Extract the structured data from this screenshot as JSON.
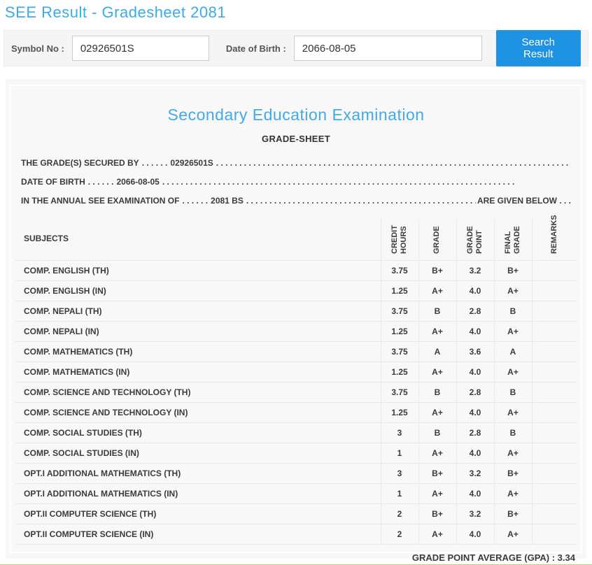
{
  "page": {
    "title": "SEE Result - Gradesheet 2081"
  },
  "search": {
    "symbol_label": "Symbol No :",
    "symbol_value": "02926501S",
    "dob_label": "Date of Birth :",
    "dob_value": "2066-08-05",
    "button_label": "Search Result"
  },
  "sheet": {
    "heading": "Secondary Education Examination",
    "subheading": "GRADE-SHEET",
    "dots_short": ". . . . . .",
    "dots_long": ". . . . . . . . . . . . . . . . . . . . . . . . . . . . . . . . . . . . . . . . . . . . . . . . . . . . . . . . . . . . . . . . . . . . . . . . . . . .",
    "lines": [
      {
        "prefix": "THE GRADE(S) SECURED BY",
        "value": "02926501S",
        "suffix": ""
      },
      {
        "prefix": "DATE OF BIRTH",
        "value": "2066-08-05",
        "suffix": ""
      },
      {
        "prefix": "IN THE ANNUAL SEE EXAMINATION OF",
        "value": "2081 BS",
        "suffix": "ARE GIVEN BELOW . . ."
      }
    ],
    "gpa_text": "GRADE POINT AVERAGE (GPA) : 3.34"
  },
  "table": {
    "headers": {
      "subjects": "SUBJECTS",
      "credit_hours": "CREDIT HOURS",
      "grade": "GRADE",
      "grade_point": "GRADE POINT",
      "final_grade": "FINAL GRADE",
      "remarks": "REMARKS"
    },
    "rows": [
      {
        "subject": "COMP. ENGLISH (TH)",
        "credit": "3.75",
        "grade": "B+",
        "point": "3.2",
        "final": "B+",
        "remarks": ""
      },
      {
        "subject": "COMP. ENGLISH (IN)",
        "credit": "1.25",
        "grade": "A+",
        "point": "4.0",
        "final": "A+",
        "remarks": ""
      },
      {
        "subject": "COMP. NEPALI (TH)",
        "credit": "3.75",
        "grade": "B",
        "point": "2.8",
        "final": "B",
        "remarks": ""
      },
      {
        "subject": "COMP. NEPALI (IN)",
        "credit": "1.25",
        "grade": "A+",
        "point": "4.0",
        "final": "A+",
        "remarks": ""
      },
      {
        "subject": "COMP. MATHEMATICS (TH)",
        "credit": "3.75",
        "grade": "A",
        "point": "3.6",
        "final": "A",
        "remarks": ""
      },
      {
        "subject": "COMP. MATHEMATICS (IN)",
        "credit": "1.25",
        "grade": "A+",
        "point": "4.0",
        "final": "A+",
        "remarks": ""
      },
      {
        "subject": "COMP. SCIENCE AND TECHNOLOGY (TH)",
        "credit": "3.75",
        "grade": "B",
        "point": "2.8",
        "final": "B",
        "remarks": ""
      },
      {
        "subject": "COMP. SCIENCE AND TECHNOLOGY (IN)",
        "credit": "1.25",
        "grade": "A+",
        "point": "4.0",
        "final": "A+",
        "remarks": ""
      },
      {
        "subject": "COMP. SOCIAL STUDIES (TH)",
        "credit": "3",
        "grade": "B",
        "point": "2.8",
        "final": "B",
        "remarks": ""
      },
      {
        "subject": "COMP. SOCIAL STUDIES (IN)",
        "credit": "1",
        "grade": "A+",
        "point": "4.0",
        "final": "A+",
        "remarks": ""
      },
      {
        "subject": "OPT.I ADDITIONAL MATHEMATICS (TH)",
        "credit": "3",
        "grade": "B+",
        "point": "3.2",
        "final": "B+",
        "remarks": ""
      },
      {
        "subject": "OPT.I ADDITIONAL MATHEMATICS (IN)",
        "credit": "1",
        "grade": "A+",
        "point": "4.0",
        "final": "A+",
        "remarks": ""
      },
      {
        "subject": "OPT.II COMPUTER SCIENCE (TH)",
        "credit": "2",
        "grade": "B+",
        "point": "3.2",
        "final": "B+",
        "remarks": ""
      },
      {
        "subject": "OPT.II COMPUTER SCIENCE (IN)",
        "credit": "2",
        "grade": "A+",
        "point": "4.0",
        "final": "A+",
        "remarks": ""
      }
    ]
  },
  "colors": {
    "title_blue": "#3aabe8",
    "heading_blue": "#41aae9",
    "button_blue": "#1e93e4",
    "footer_green": "#bccf7d"
  }
}
